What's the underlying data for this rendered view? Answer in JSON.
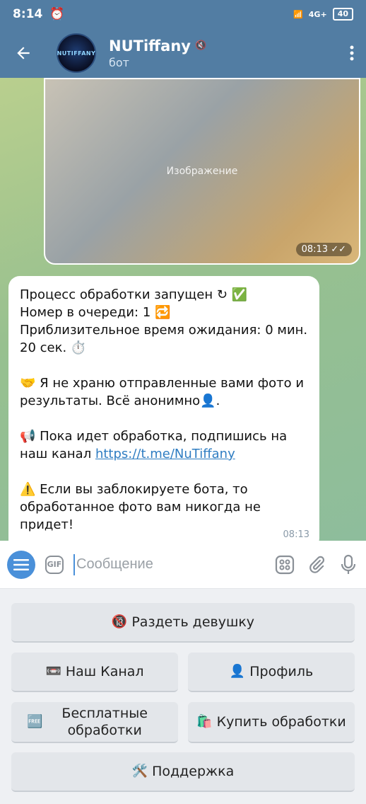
{
  "status": {
    "time": "8:14",
    "network": "4G+",
    "battery": "40"
  },
  "header": {
    "avatar_text": "NUTIFFANY",
    "title": "NUTiffany",
    "subtitle": "бот"
  },
  "messages": {
    "photo": {
      "placeholder": "Изображение",
      "time": "08:13"
    },
    "text": {
      "line1": "Процесс обработки запущен ↻ ✅",
      "line2": "Номер в очереди: 1 🔁",
      "line3": "Приблизительное время ожидания: 0 мин. 20 сек. ⏱️",
      "privacy": "🤝 Я не храню отправленные вами фото и результаты. Всё анонимно👤.",
      "subscribe": "📢 Пока идет обработка, подпишись на наш канал",
      "link": "https://t.me/NuTiffany",
      "warning": "⚠️ Если вы заблокируете бота, то обработанное фото вам никогда не придет!",
      "time": "08:13"
    }
  },
  "input": {
    "gif_label": "GIF",
    "placeholder": "Сообщение"
  },
  "keyboard": {
    "btn_undress": {
      "emoji": "🔞",
      "label": "Раздеть девушку"
    },
    "btn_channel": {
      "emoji": "📼",
      "label": "Наш Канал"
    },
    "btn_profile": {
      "emoji": "👤",
      "label": "Профиль"
    },
    "btn_free": {
      "emoji": "🆓",
      "label": "Бесплатные обработки"
    },
    "btn_buy": {
      "emoji": "🛍️",
      "label": "Купить обработки"
    },
    "btn_support": {
      "emoji": "🛠️",
      "label": "Поддержка"
    }
  },
  "colors": {
    "header": "#527da3",
    "accent": "#4a90d9",
    "link": "#2f7dc2"
  }
}
